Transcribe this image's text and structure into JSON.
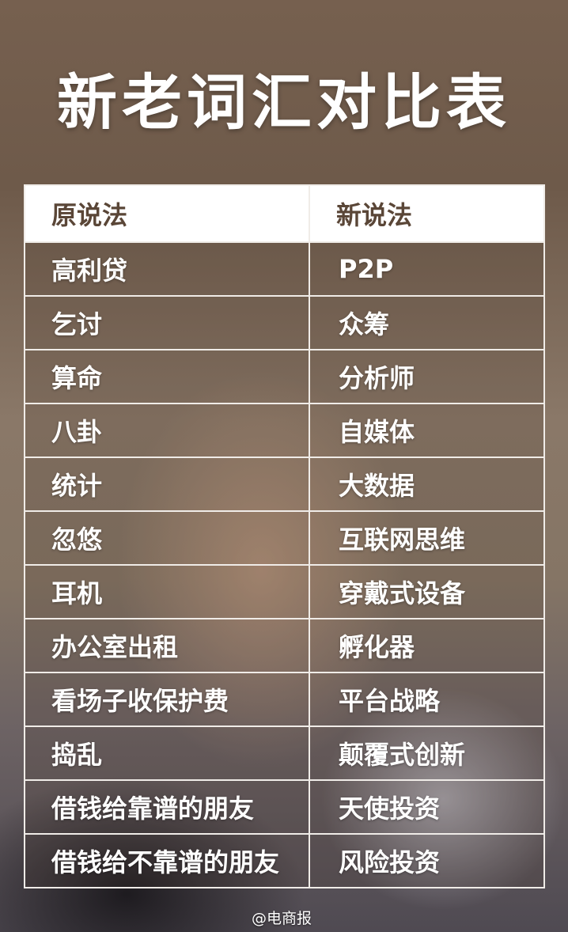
{
  "title": "新老词汇对比表",
  "table": {
    "headers": [
      "原说法",
      "新说法"
    ],
    "rows": [
      [
        "高利贷",
        "P2P"
      ],
      [
        "乞讨",
        "众筹"
      ],
      [
        "算命",
        "分析师"
      ],
      [
        "八卦",
        "自媒体"
      ],
      [
        "统计",
        "大数据"
      ],
      [
        "忽悠",
        "互联网思维"
      ],
      [
        "耳机",
        "穿戴式设备"
      ],
      [
        "办公室出租",
        "孵化器"
      ],
      [
        "看场子收保护费",
        "平台战略"
      ],
      [
        "捣乱",
        "颠覆式创新"
      ],
      [
        "借钱给靠谱的朋友",
        "天使投资"
      ],
      [
        "借钱给不靠谱的朋友",
        "风险投资"
      ]
    ]
  },
  "watermark": "@电商报"
}
